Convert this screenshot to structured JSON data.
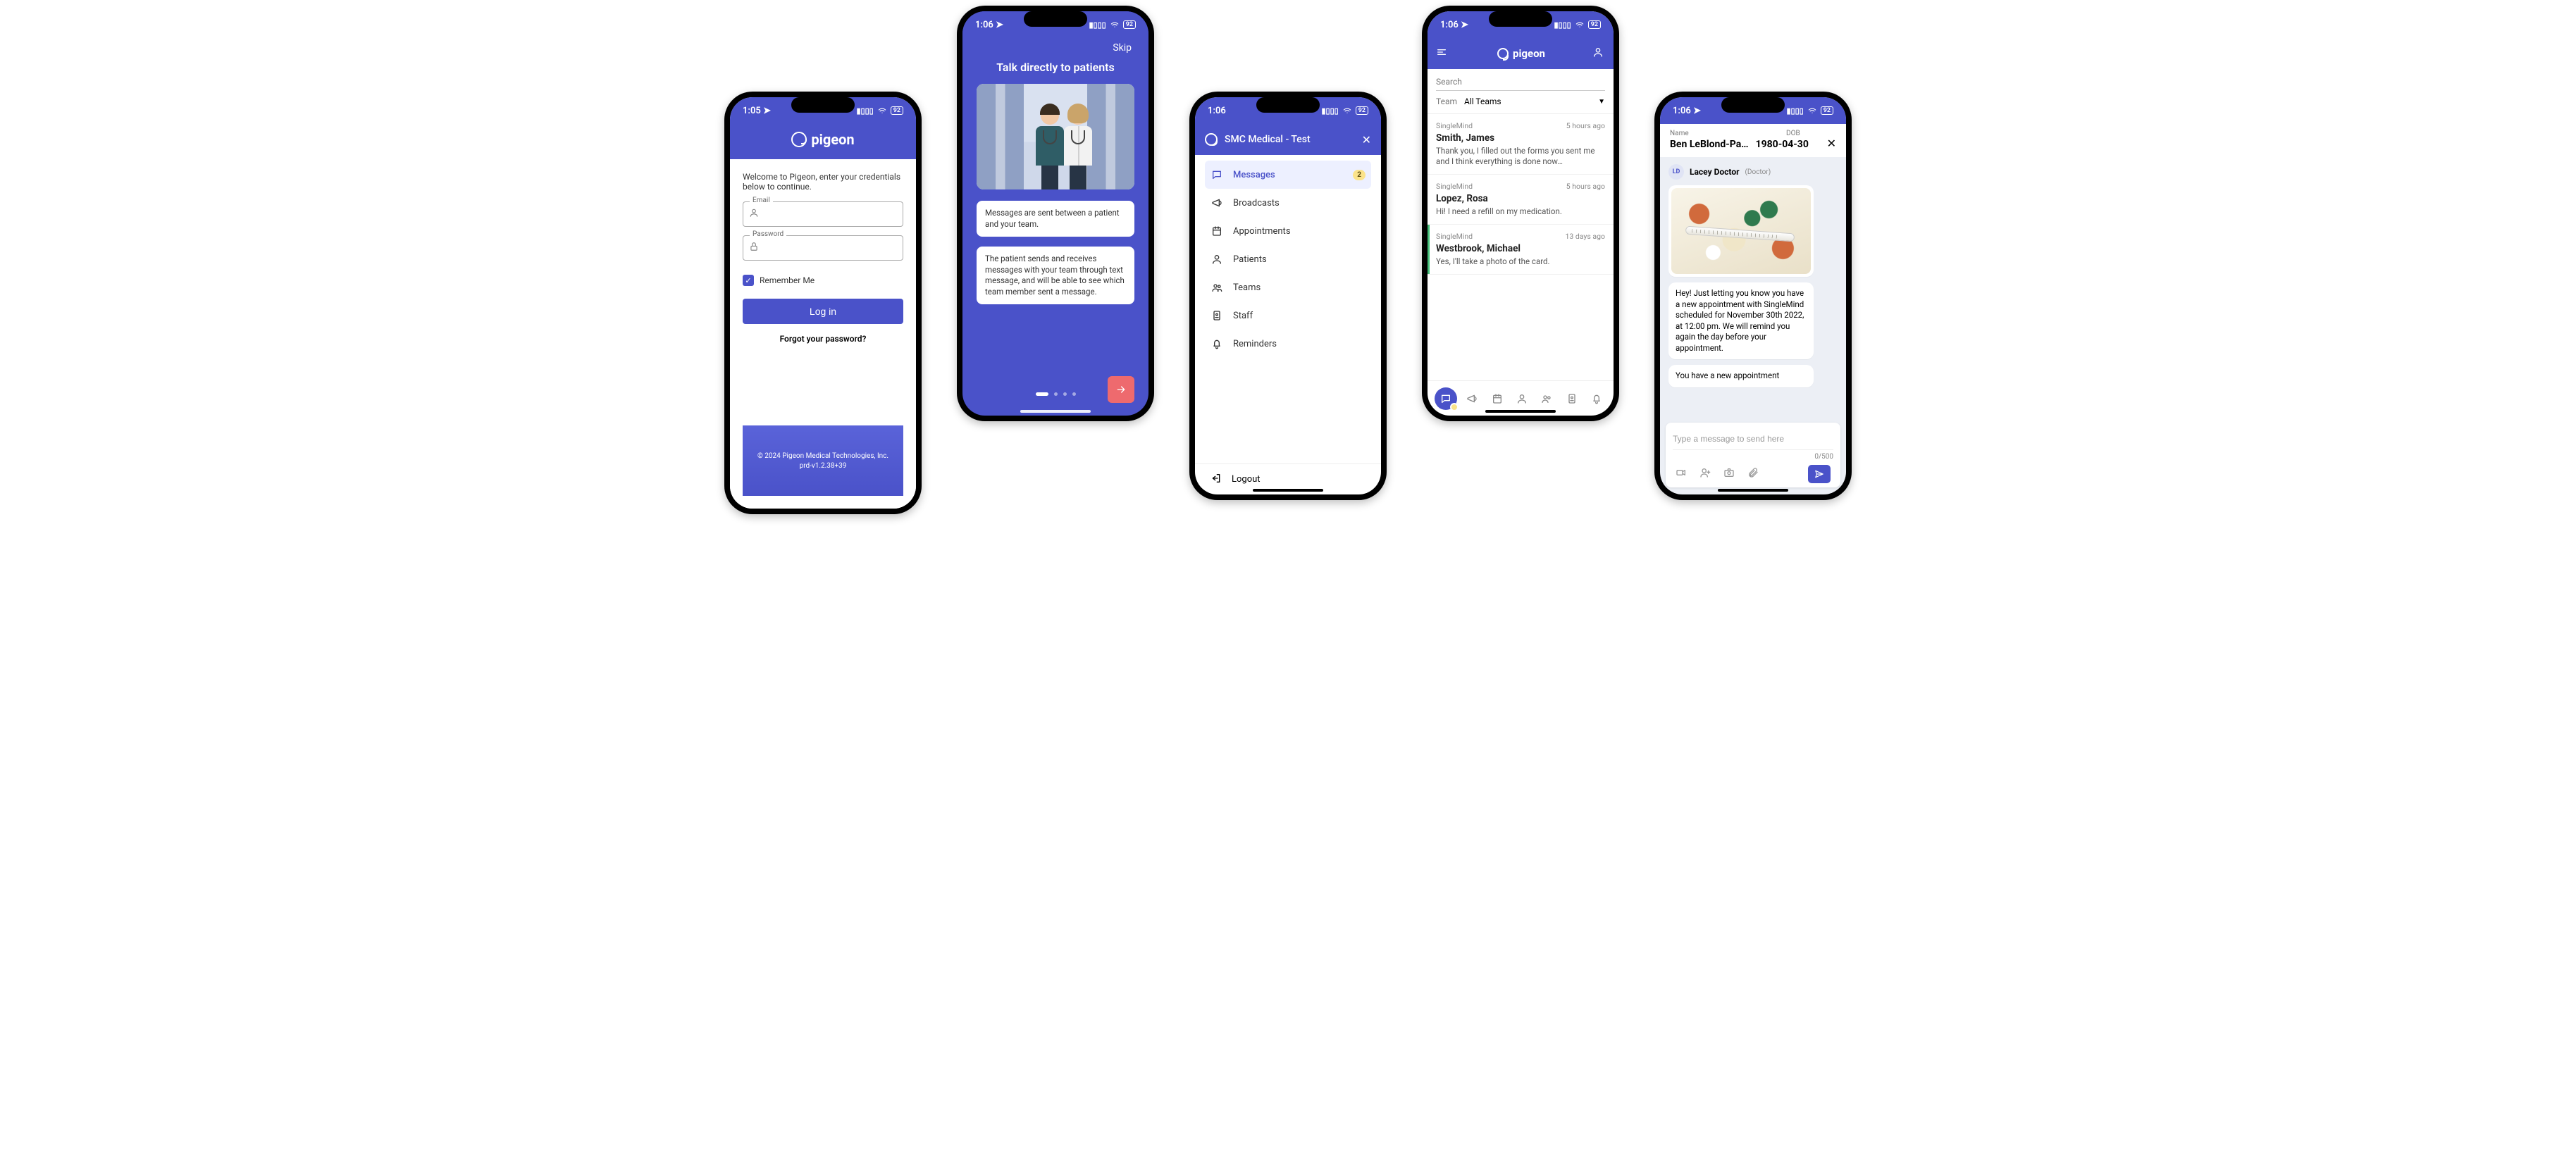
{
  "screen1": {
    "status": {
      "time": "1:05",
      "battery": "92"
    },
    "brand": "pigeon",
    "welcome_text": "Welcome to Pigeon, enter your credentials below to continue.",
    "email": {
      "label": "Email"
    },
    "password": {
      "label": "Password"
    },
    "remember_label": "Remember Me",
    "login_button": "Log in",
    "forgot_link": "Forgot your password?",
    "copyright": "© 2024 Pigeon Medical Technologies, Inc.",
    "version": "prd-v1.2.38+39"
  },
  "screen2": {
    "status": {
      "time": "1:06",
      "battery": "92"
    },
    "skip": "Skip",
    "title": "Talk directly to patients",
    "card1": "Messages are sent between a patient and your team.",
    "card2": "The patient sends and receives messages with your team through text message, and will be able to see which team member sent a message."
  },
  "screen3": {
    "status": {
      "time": "1:06",
      "battery": "92"
    },
    "header_title": "SMC Medical - Test",
    "items": [
      {
        "label": "Messages",
        "badge": "2"
      },
      {
        "label": "Broadcasts"
      },
      {
        "label": "Appointments"
      },
      {
        "label": "Patients"
      },
      {
        "label": "Teams"
      },
      {
        "label": "Staff"
      },
      {
        "label": "Reminders"
      }
    ],
    "logout": "Logout"
  },
  "screen4": {
    "status": {
      "time": "1:06",
      "battery": "92"
    },
    "brand": "pigeon",
    "search_placeholder": "Search",
    "team_label": "Team",
    "team_value": "All Teams",
    "conversations": [
      {
        "team": "SingleMind",
        "ago": "5 hours ago",
        "name": "Smith, James",
        "preview": "Thank you, I filled out the forms you sent me and I think everything is done now…"
      },
      {
        "team": "SingleMind",
        "ago": "5 hours ago",
        "name": "Lopez, Rosa",
        "preview": "Hi! I need a refill on my medication."
      },
      {
        "team": "SingleMind",
        "ago": "13 days ago",
        "name": "Westbrook, Michael",
        "preview": "Yes, I'll take a photo of the card."
      }
    ]
  },
  "screen5": {
    "status": {
      "time": "1:06",
      "battery": "92"
    },
    "name_label": "Name",
    "dob_label": "DOB",
    "patient_name": "Ben LeBlond-Pa…",
    "patient_dob": "1980-04-30",
    "sender": {
      "initials": "LD",
      "name": "Lacey Doctor",
      "role": "(Doctor)"
    },
    "msg_appointment": "Hey! Just letting you know you have a new appointment with SingleMind scheduled for November 30th 2022, at 12:00 pm. We will remind you again the day before your appointment.",
    "msg_new_appt": "You have a new appointment",
    "composer_placeholder": "Type a message to send here",
    "char_count": "0/500"
  }
}
